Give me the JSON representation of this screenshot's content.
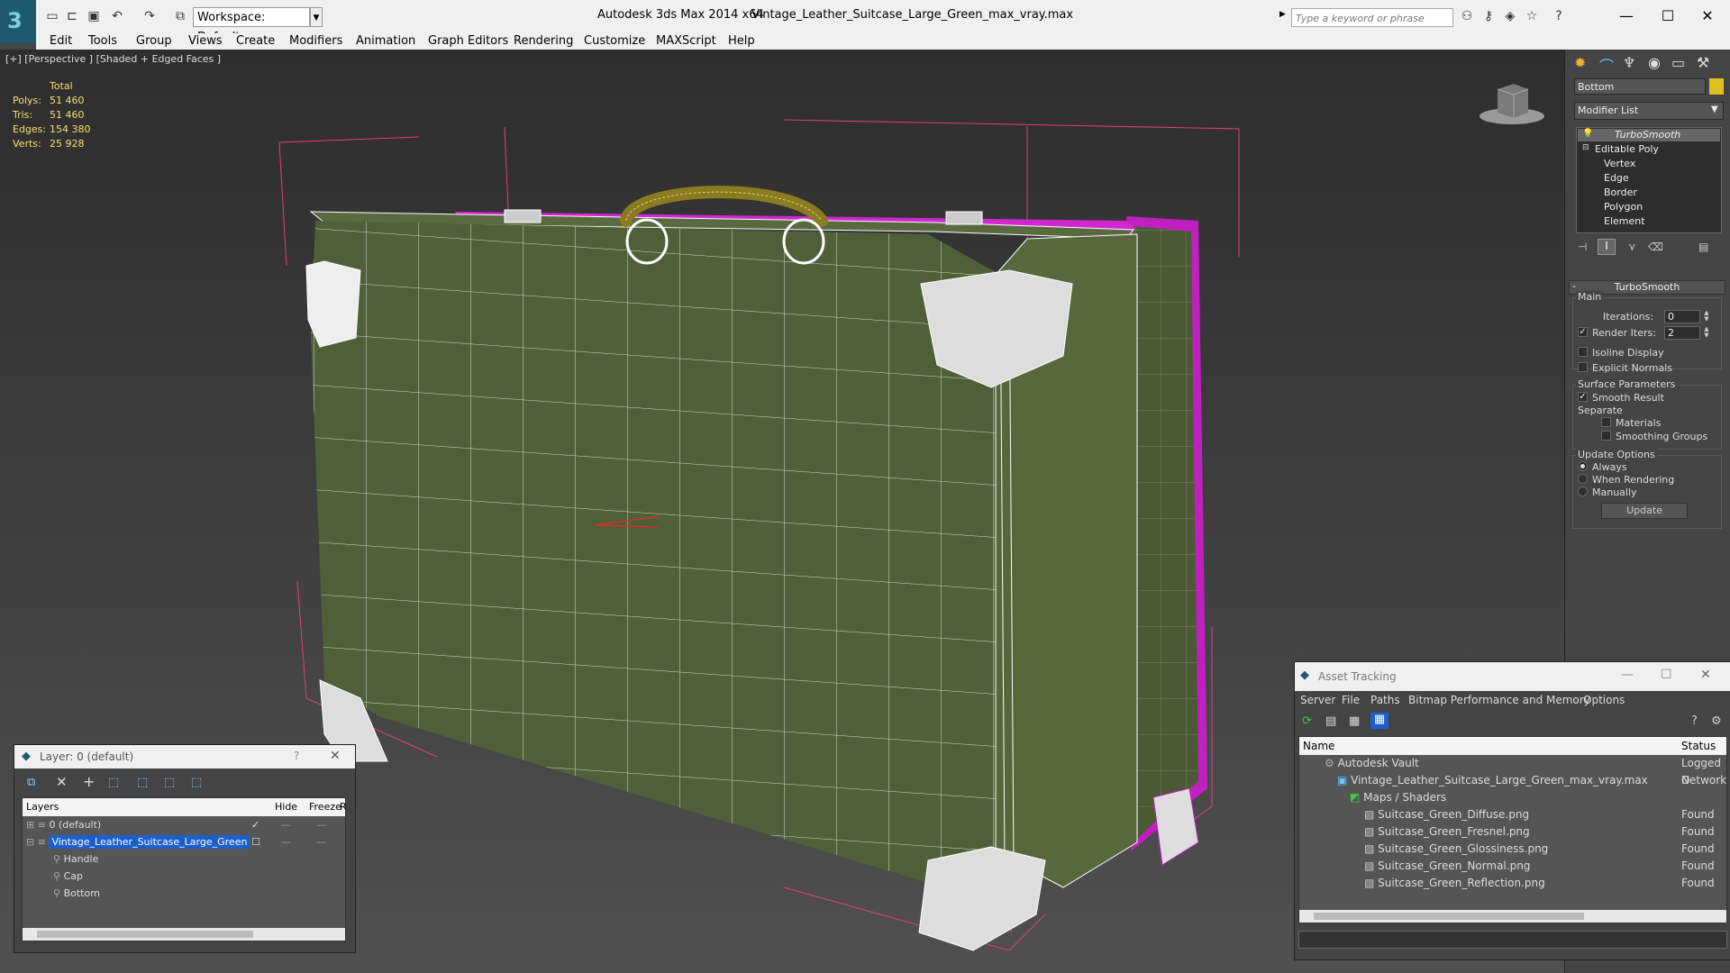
{
  "titlebar": {
    "app_title": "Autodesk 3ds Max  2014 x64",
    "file_title": "Vintage_Leather_Suitcase_Large_Green_max_vray.max",
    "workspace": "Workspace: Default",
    "search_placeholder": "Type a keyword or phrase"
  },
  "menu": [
    "Edit",
    "Tools",
    "Group",
    "Views",
    "Create",
    "Modifiers",
    "Animation",
    "Graph Editors",
    "Rendering",
    "Customize",
    "MAXScript",
    "Help"
  ],
  "viewport": {
    "label": "[+] [Perspective ] [Shaded + Edged Faces ]",
    "stats": {
      "header": "Total",
      "rows": [
        {
          "label": "Polys:",
          "value": "51 460"
        },
        {
          "label": "Tris:",
          "value": "51 460"
        },
        {
          "label": "Edges:",
          "value": "154 380"
        },
        {
          "label": "Verts:",
          "value": "25 928"
        }
      ]
    }
  },
  "command_panel": {
    "object_name": "Bottom",
    "modifier_list": "Modifier List",
    "stack": [
      "TurboSmooth",
      "Editable Poly",
      "Vertex",
      "Edge",
      "Border",
      "Polygon",
      "Element"
    ],
    "turbosmooth": {
      "title": "TurboSmooth",
      "main": "Main",
      "iterations_label": "Iterations:",
      "iterations": "0",
      "render_iters_label": "Render Iters:",
      "render_iters": "2",
      "isoline": "Isoline Display",
      "explicit_normals": "Explicit Normals",
      "surface_params": "Surface Parameters",
      "smooth_result": "Smooth Result",
      "separate": "Separate",
      "materials": "Materials",
      "smoothing_groups": "Smoothing Groups",
      "update_options": "Update Options",
      "always": "Always",
      "when_rendering": "When Rendering",
      "manually": "Manually",
      "update_button": "Update"
    }
  },
  "layer_dialog": {
    "title": "Layer: 0 (default)",
    "columns": [
      "Layers",
      "Hide",
      "Freeze",
      "R"
    ],
    "rows": [
      "0 (default)",
      "Vintage_Leather_Suitcase_Large_Green",
      "Handle",
      "Cap",
      "Bottom"
    ]
  },
  "asset_tracking": {
    "title": "Asset Tracking",
    "menu": [
      "Server",
      "File",
      "Paths",
      "Bitmap Performance and Memory",
      "Options"
    ],
    "columns": [
      "Name",
      "Status"
    ],
    "rows": [
      {
        "name": "Autodesk Vault",
        "status": "Logged O"
      },
      {
        "name": "Vintage_Leather_Suitcase_Large_Green_max_vray.max",
        "status": "Network"
      },
      {
        "name": "Maps / Shaders",
        "status": ""
      },
      {
        "name": "Suitcase_Green_Diffuse.png",
        "status": "Found"
      },
      {
        "name": "Suitcase_Green_Fresnel.png",
        "status": "Found"
      },
      {
        "name": "Suitcase_Green_Glossiness.png",
        "status": "Found"
      },
      {
        "name": "Suitcase_Green_Normal.png",
        "status": "Found"
      },
      {
        "name": "Suitcase_Green_Reflection.png",
        "status": "Found"
      }
    ]
  },
  "colors": {
    "suitcase": "#4f6038",
    "wire": "#ffffff",
    "selection": "#d028d0",
    "handle": "#8a7a20",
    "bbox": "#e04080",
    "stats": "#f0e070",
    "selected_row": "#1b5fcc"
  }
}
